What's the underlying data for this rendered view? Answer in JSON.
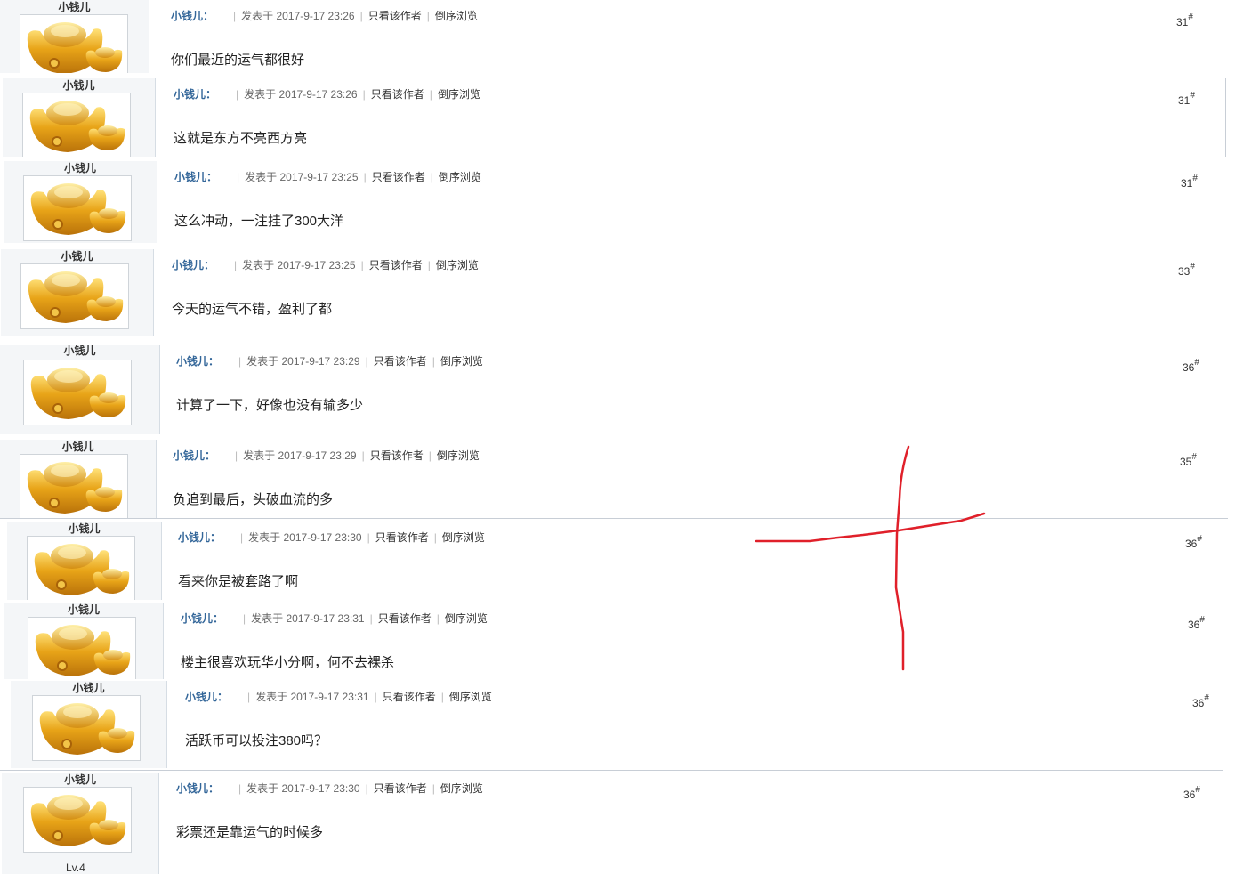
{
  "labels": {
    "posted_prefix": "发表于",
    "only_author": "只看该作者",
    "reverse_view": "倒序浏览",
    "floor_suffix": "#"
  },
  "posts": [
    {
      "author": "小钱儿",
      "username": "小钱儿：",
      "time": "2017-9-17 23:26",
      "content": "你们最近的运气都很好",
      "floor": "31"
    },
    {
      "author": "小钱儿",
      "username": "小钱儿：",
      "time": "2017-9-17 23:26",
      "content": "这就是东方不亮西方亮",
      "floor": "31"
    },
    {
      "author": "小钱儿",
      "username": "小钱儿：",
      "time": "2017-9-17 23:25",
      "content": "这么冲动，一注挂了300大洋",
      "floor": "31"
    },
    {
      "author": "小钱儿",
      "username": "小钱儿：",
      "time": "2017-9-17 23:25",
      "content": "今天的运气不错，盈利了都",
      "floor": "33"
    },
    {
      "author": "小钱儿",
      "username": "小钱儿：",
      "time": "2017-9-17 23:29",
      "content": "计算了一下，好像也没有输多少",
      "floor": "36"
    },
    {
      "author": "小钱儿",
      "username": "小钱儿：",
      "time": "2017-9-17 23:29",
      "content": "负追到最后，头破血流的多",
      "floor": "35"
    },
    {
      "author": "小钱儿",
      "username": "小钱儿：",
      "time": "2017-9-17 23:30",
      "content": "看来你是被套路了啊",
      "floor": "36"
    },
    {
      "author": "小钱儿",
      "username": "小钱儿：",
      "time": "2017-9-17 23:31",
      "content": "楼主很喜欢玩华小分啊，何不去裸杀",
      "floor": "36"
    },
    {
      "author": "小钱儿",
      "username": "小钱儿：",
      "time": "2017-9-17 23:31",
      "content": "活跃币可以投注380吗？",
      "floor": "36"
    },
    {
      "author": "小钱儿",
      "username": "小钱儿：",
      "time": "2017-9-17 23:30",
      "content": "彩票还是靠运气的时候多",
      "floor": "36",
      "level": "Lv.4"
    }
  ],
  "colors": {
    "username": "#336699",
    "annotation": "#e0202a",
    "gold": "#e8a418"
  },
  "icons": {
    "avatar": "gold-ingot-icon"
  }
}
